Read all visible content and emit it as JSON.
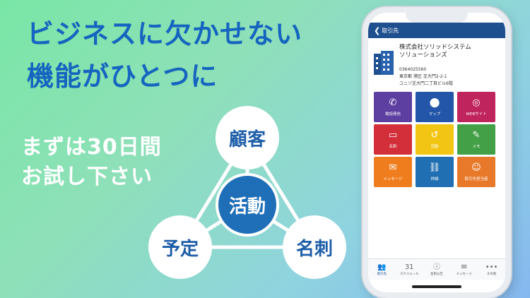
{
  "headline": {
    "line1": "ビジネスに欠かせない",
    "line2": "機能がひとつに"
  },
  "subtext": {
    "line1": "まずは30日間",
    "line2": "お試し下さい"
  },
  "diagram": {
    "top": "顧客",
    "center": "活動",
    "left": "予定",
    "right": "名刺"
  },
  "phone": {
    "header": {
      "back_label": "取引先"
    },
    "company": {
      "name_line1": "株式会社ソリッドシステム",
      "name_line2": "ソリューションズ",
      "phone": "0364025560",
      "address1": "東京都 港区 芝大門2-2-1",
      "address2": "ユニゾ芝大門二丁目ビル6階"
    },
    "tiles": [
      {
        "label": "電話発信",
        "icon": "phone-icon",
        "glyph": "✆",
        "color": "#5c3fa0"
      },
      {
        "label": "マップ",
        "icon": "map-pin-icon",
        "glyph": "⬤",
        "color": "#2356a8"
      },
      {
        "label": "WEBサイト",
        "icon": "globe-icon",
        "glyph": "◎",
        "color": "#c0245c"
      },
      {
        "label": "名刺",
        "icon": "business-card-icon",
        "glyph": "▭",
        "color": "#d32f3a"
      },
      {
        "label": "活動",
        "icon": "history-icon",
        "glyph": "↺",
        "color": "#f2c514"
      },
      {
        "label": "メモ",
        "icon": "memo-icon",
        "glyph": "✎",
        "color": "#43a047"
      },
      {
        "label": "メッセージ",
        "icon": "message-icon",
        "glyph": "✉",
        "color": "#ef7d1d"
      },
      {
        "label": "詳細",
        "icon": "link-icon",
        "glyph": "⛓",
        "color": "#1f6fb2"
      },
      {
        "label": "取引先担当者",
        "icon": "contacts-icon",
        "glyph": "☺",
        "color": "#e8792a"
      }
    ],
    "tabs": [
      {
        "label": "取引先",
        "icon": "people-icon",
        "glyph": "👥"
      },
      {
        "label": "スケジュール",
        "icon": "calendar-icon",
        "glyph": "31"
      },
      {
        "label": "名刺公告",
        "icon": "info-icon",
        "glyph": "ⓘ"
      },
      {
        "label": "メッセージ",
        "icon": "chat-icon",
        "glyph": "✉"
      },
      {
        "label": "その他",
        "icon": "more-icon",
        "glyph": "•••"
      }
    ]
  }
}
